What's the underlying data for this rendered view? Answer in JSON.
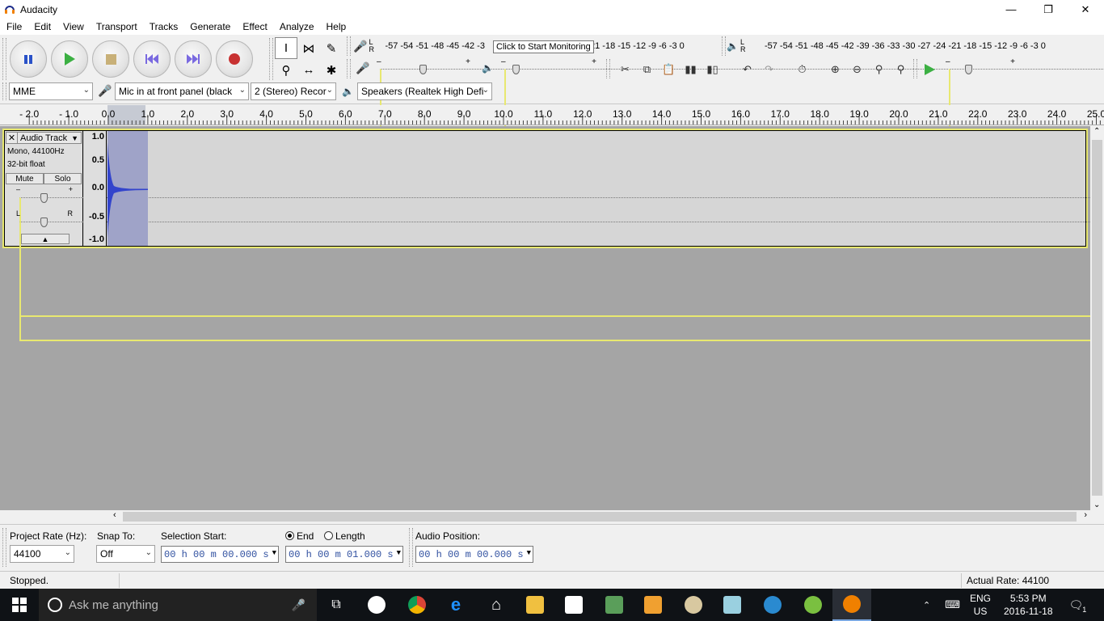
{
  "window": {
    "title": "Audacity"
  },
  "menu": [
    "File",
    "Edit",
    "View",
    "Transport",
    "Tracks",
    "Generate",
    "Effect",
    "Analyze",
    "Help"
  ],
  "meters": {
    "record_ticks": "-57 -54 -51 -48 -45 -42 -3",
    "record_ticks_tail": "21 -18 -15 -12  -9  -6  -3  0",
    "play_ticks": "-57 -54 -51 -48 -45 -42 -39 -36 -33 -30 -27 -24 -21 -18 -15 -12  -9  -6  -3  0",
    "lr_top": "L",
    "lr_bottom": "R",
    "tooltip": "Click to Start Monitoring"
  },
  "device": {
    "host": "MME",
    "input": "Mic in at front panel (black",
    "channels": "2 (Stereo) Recor",
    "output": "Speakers (Realtek High Defi"
  },
  "ruler": [
    "- 2.0",
    "- 1.0",
    "0.0",
    "1.0",
    "2.0",
    "3.0",
    "4.0",
    "5.0",
    "6.0",
    "7.0",
    "8.0",
    "9.0",
    "10.0",
    "11.0",
    "12.0",
    "13.0",
    "14.0",
    "15.0",
    "16.0",
    "17.0",
    "18.0",
    "19.0",
    "20.0",
    "21.0",
    "22.0",
    "23.0",
    "24.0",
    "25.0"
  ],
  "track": {
    "close": "✕",
    "name": "Audio Track",
    "format": "Mono, 44100Hz",
    "bits": "32-bit float",
    "mute": "Mute",
    "solo": "Solo",
    "gain_minus": "–",
    "gain_plus": "+",
    "pan_l": "L",
    "pan_r": "R",
    "scale": [
      "1.0",
      "0.5",
      "0.0",
      "-0.5",
      "-1.0"
    ]
  },
  "selection": {
    "rate_label": "Project Rate (Hz):",
    "rate_value": "44100",
    "snap_label": "Snap To:",
    "snap_value": "Off",
    "start_label": "Selection Start:",
    "start_value": "00 h 00 m 00.000 s",
    "end_label": "End",
    "length_label": "Length",
    "end_value": "00 h 00 m 01.000 s",
    "pos_label": "Audio Position:",
    "pos_value": "00 h 00 m 00.000 s"
  },
  "status": {
    "left": "Stopped.",
    "right": "Actual Rate: 44100"
  },
  "taskbar": {
    "search": "Ask me anything",
    "lang": "ENG",
    "region": "US",
    "time": "5:53 PM",
    "date": "2016-11-18",
    "notifications": "1"
  },
  "colors": {
    "waveform": "#3344cc",
    "selection": "#9fa3c8",
    "track_bg": "#d6d6d6",
    "track_border": "#e8e870"
  }
}
